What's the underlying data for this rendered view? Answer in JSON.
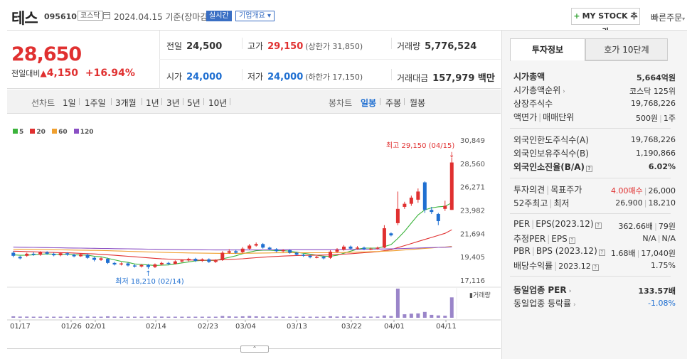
{
  "header": {
    "name": "테스",
    "code": "095610",
    "market": "코스닥",
    "date_text": "2024.04.15 기준(장마감)",
    "live_label": "실시간",
    "overview_label": "기업개요",
    "mystock_label": "MY STOCK 추가",
    "quick_order": "빠른주문"
  },
  "price": {
    "current": "28,650",
    "change_label": "전일대비",
    "change_value": "4,150",
    "change_pct": "+16.94%",
    "prev_label": "전일",
    "prev_value": "24,500",
    "high_label": "고가",
    "high_value": "29,150",
    "upper_limit": "(상한가 31,850)",
    "volume_label": "거래량",
    "volume_value": "5,776,524",
    "open_label": "시가",
    "open_value": "24,000",
    "low_label": "저가",
    "low_value": "24,000",
    "lower_limit": "(하한가 17,150)",
    "amount_label": "거래대금",
    "amount_value": "157,979 백만"
  },
  "periods": {
    "line_chart": "선차트",
    "items": [
      "1일",
      "1주일",
      "3개월",
      "1년",
      "3년",
      "5년",
      "10년"
    ],
    "candle_chart": "봉차트",
    "candle_items": [
      "일봉",
      "주봉",
      "월봉"
    ],
    "candle_active": "일봉"
  },
  "legend": [
    {
      "label": "5",
      "color": "#3bb33b"
    },
    {
      "label": "20",
      "color": "#e03030"
    },
    {
      "label": "60",
      "color": "#f0a030"
    },
    {
      "label": "120",
      "color": "#8a4fc4"
    }
  ],
  "chart_data": {
    "type": "candlestick",
    "y_ticks": [
      "30,849",
      "28,560",
      "26,271",
      "23,982",
      "21,694",
      "19,405",
      "17,116"
    ],
    "ylim": [
      17116,
      30849
    ],
    "x_labels": [
      "01/17",
      "01/26",
      "02/01",
      "02/14",
      "02/23",
      "03/04",
      "03/13",
      "03/22",
      "04/01",
      "04/11"
    ],
    "high_annotation": "최고 29,150 (04/15)",
    "low_annotation": "최저 18,210 (02/14)",
    "volume_label": "거래량",
    "candles": [
      {
        "o": 19800,
        "c": 19500,
        "h": 19950,
        "l": 19350
      },
      {
        "o": 19400,
        "c": 19250,
        "h": 19500,
        "l": 19150
      },
      {
        "o": 19500,
        "c": 19700,
        "h": 19800,
        "l": 19400
      },
      {
        "o": 19700,
        "c": 19600,
        "h": 19850,
        "l": 19500
      },
      {
        "o": 19600,
        "c": 19850,
        "h": 19950,
        "l": 19500
      },
      {
        "o": 19850,
        "c": 19700,
        "h": 19950,
        "l": 19600
      },
      {
        "o": 19700,
        "c": 19550,
        "h": 19800,
        "l": 19450
      },
      {
        "o": 19550,
        "c": 19750,
        "h": 19850,
        "l": 19450
      },
      {
        "o": 19750,
        "c": 19600,
        "h": 19850,
        "l": 19500
      },
      {
        "o": 19600,
        "c": 19450,
        "h": 19700,
        "l": 19350
      },
      {
        "o": 19450,
        "c": 19650,
        "h": 19750,
        "l": 19400
      },
      {
        "o": 19600,
        "c": 19300,
        "h": 19700,
        "l": 19200
      },
      {
        "o": 19300,
        "c": 19100,
        "h": 19400,
        "l": 18950
      },
      {
        "o": 19100,
        "c": 19250,
        "h": 19350,
        "l": 19000
      },
      {
        "o": 19200,
        "c": 18800,
        "h": 19300,
        "l": 18700
      },
      {
        "o": 18800,
        "c": 18650,
        "h": 18900,
        "l": 18550
      },
      {
        "o": 18650,
        "c": 18750,
        "h": 18850,
        "l": 18550
      },
      {
        "o": 18750,
        "c": 18550,
        "h": 18850,
        "l": 18450
      },
      {
        "o": 18550,
        "c": 18450,
        "h": 18650,
        "l": 18350
      },
      {
        "o": 18450,
        "c": 18600,
        "h": 18700,
        "l": 18350
      },
      {
        "o": 18600,
        "c": 18400,
        "h": 18700,
        "l": 18210
      },
      {
        "o": 18400,
        "c": 18650,
        "h": 18750,
        "l": 18300
      },
      {
        "o": 18650,
        "c": 18800,
        "h": 18900,
        "l": 18550
      },
      {
        "o": 18800,
        "c": 18700,
        "h": 18900,
        "l": 18600
      },
      {
        "o": 18700,
        "c": 18950,
        "h": 19050,
        "l": 18650
      },
      {
        "o": 18950,
        "c": 19050,
        "h": 19150,
        "l": 18850
      },
      {
        "o": 19050,
        "c": 19200,
        "h": 19300,
        "l": 18950
      },
      {
        "o": 19200,
        "c": 19000,
        "h": 19300,
        "l": 18900
      },
      {
        "o": 19000,
        "c": 19150,
        "h": 19250,
        "l": 18900
      },
      {
        "o": 19150,
        "c": 18900,
        "h": 19250,
        "l": 18800
      },
      {
        "o": 18900,
        "c": 19050,
        "h": 19150,
        "l": 18800
      },
      {
        "o": 19100,
        "c": 19800,
        "h": 19950,
        "l": 19000
      },
      {
        "o": 19800,
        "c": 19950,
        "h": 20150,
        "l": 19700
      },
      {
        "o": 19950,
        "c": 19800,
        "h": 20100,
        "l": 19700
      },
      {
        "o": 19850,
        "c": 20200,
        "h": 20350,
        "l": 19750
      },
      {
        "o": 20200,
        "c": 20500,
        "h": 20650,
        "l": 20100
      },
      {
        "o": 20500,
        "c": 20650,
        "h": 20800,
        "l": 20400
      },
      {
        "o": 20650,
        "c": 20300,
        "h": 20750,
        "l": 20200
      },
      {
        "o": 20300,
        "c": 20150,
        "h": 20400,
        "l": 20050
      },
      {
        "o": 20150,
        "c": 19950,
        "h": 20250,
        "l": 19850
      },
      {
        "o": 19950,
        "c": 20050,
        "h": 20150,
        "l": 19850
      },
      {
        "o": 20050,
        "c": 19800,
        "h": 20150,
        "l": 19700
      },
      {
        "o": 19800,
        "c": 19600,
        "h": 19900,
        "l": 19500
      },
      {
        "o": 19600,
        "c": 19500,
        "h": 19700,
        "l": 19400
      },
      {
        "o": 19500,
        "c": 19350,
        "h": 19600,
        "l": 19250
      },
      {
        "o": 19350,
        "c": 19400,
        "h": 19500,
        "l": 19250
      },
      {
        "o": 19400,
        "c": 19250,
        "h": 19500,
        "l": 19150
      },
      {
        "o": 19300,
        "c": 19900,
        "h": 20050,
        "l": 19200
      },
      {
        "o": 19900,
        "c": 20100,
        "h": 20250,
        "l": 19800
      },
      {
        "o": 20100,
        "c": 20400,
        "h": 20550,
        "l": 20000
      },
      {
        "o": 20400,
        "c": 20200,
        "h": 20500,
        "l": 20100
      },
      {
        "o": 20200,
        "c": 20300,
        "h": 20450,
        "l": 20100
      },
      {
        "o": 20300,
        "c": 20150,
        "h": 20400,
        "l": 20050
      },
      {
        "o": 20150,
        "c": 20200,
        "h": 20300,
        "l": 20050
      },
      {
        "o": 20200,
        "c": 20300,
        "h": 20400,
        "l": 20100
      },
      {
        "o": 20300,
        "c": 22200,
        "h": 22500,
        "l": 20250
      },
      {
        "o": 21700,
        "c": 21500,
        "h": 21800,
        "l": 21400
      },
      {
        "o": 22700,
        "c": 24100,
        "h": 25800,
        "l": 22500
      },
      {
        "o": 24300,
        "c": 24600,
        "h": 24800,
        "l": 24100
      },
      {
        "o": 24600,
        "c": 25200,
        "h": 25400,
        "l": 24400
      },
      {
        "o": 25000,
        "c": 25800,
        "h": 26100,
        "l": 24700
      },
      {
        "o": 26700,
        "c": 24000,
        "h": 26800,
        "l": 23700
      },
      {
        "o": 24000,
        "c": 23800,
        "h": 24300,
        "l": 23600
      },
      {
        "o": 23600,
        "c": 22900,
        "h": 23700,
        "l": 22500
      },
      {
        "o": 24100,
        "c": 24400,
        "h": 24900,
        "l": 23900
      },
      {
        "o": 24000,
        "c": 28650,
        "h": 29150,
        "l": 24000
      }
    ],
    "volume_levels": [
      0.05,
      0.04,
      0.04,
      0.03,
      0.03,
      0.03,
      0.03,
      0.03,
      0.03,
      0.03,
      0.03,
      0.04,
      0.03,
      0.03,
      0.05,
      0.04,
      0.03,
      0.03,
      0.03,
      0.03,
      0.04,
      0.04,
      0.04,
      0.03,
      0.03,
      0.03,
      0.03,
      0.03,
      0.03,
      0.03,
      0.03,
      0.06,
      0.05,
      0.04,
      0.05,
      0.06,
      0.05,
      0.04,
      0.04,
      0.04,
      0.03,
      0.03,
      0.03,
      0.03,
      0.03,
      0.03,
      0.03,
      0.05,
      0.04,
      0.05,
      0.04,
      0.04,
      0.04,
      0.04,
      0.04,
      0.08,
      0.06,
      1.0,
      0.12,
      0.14,
      0.15,
      0.2,
      0.1,
      0.08,
      0.07,
      0.7
    ],
    "ma_lines": [
      {
        "name": "5",
        "color": "#3bb33b",
        "values": [
          19600,
          19550,
          19560,
          19600,
          19650,
          19680,
          19660,
          19640,
          19650,
          19600,
          19580,
          19560,
          19450,
          19400,
          19250,
          19100,
          18950,
          18850,
          18700,
          18650,
          18600,
          18550,
          18580,
          18600,
          18700,
          18800,
          18900,
          19000,
          19050,
          19050,
          19050,
          19200,
          19350,
          19500,
          19700,
          19850,
          20000,
          20050,
          20050,
          20000,
          20000,
          19950,
          19850,
          19750,
          19650,
          19550,
          19450,
          19450,
          19550,
          19750,
          19950,
          20150,
          20250,
          20250,
          20250,
          20400,
          20600,
          21200,
          21900,
          22700,
          23500,
          24000,
          24200,
          24300,
          24350,
          24700
        ]
      },
      {
        "name": "20",
        "color": "#e03030",
        "values": [
          19950,
          19930,
          19910,
          19890,
          19870,
          19850,
          19830,
          19810,
          19790,
          19770,
          19740,
          19710,
          19680,
          19640,
          19600,
          19550,
          19500,
          19450,
          19400,
          19350,
          19300,
          19250,
          19200,
          19170,
          19140,
          19110,
          19090,
          19080,
          19070,
          19070,
          19080,
          19100,
          19130,
          19170,
          19210,
          19260,
          19310,
          19360,
          19400,
          19440,
          19470,
          19500,
          19520,
          19540,
          19550,
          19560,
          19570,
          19590,
          19620,
          19660,
          19700,
          19750,
          19800,
          19850,
          19900,
          20000,
          20100,
          20300,
          20500,
          20700,
          20900,
          21100,
          21300,
          21500,
          21700,
          22050
        ]
      },
      {
        "name": "60",
        "color": "#f0a030",
        "values": [
          20150,
          20140,
          20130,
          20120,
          20110,
          20100,
          20090,
          20080,
          20070,
          20060,
          20050,
          20040,
          20030,
          20020,
          20000,
          19980,
          19960,
          19940,
          19920,
          19900,
          19880,
          19860,
          19840,
          19820,
          19800,
          19790,
          19780,
          19770,
          19760,
          19750,
          19745,
          19740,
          19740,
          19740,
          19745,
          19750,
          19760,
          19770,
          19780,
          19790,
          19795,
          19800,
          19800,
          19800,
          19800,
          19800,
          19800,
          19800,
          19810,
          19820,
          19840,
          19860,
          19880,
          19900,
          19920,
          19950,
          19980,
          20020,
          20070,
          20120,
          20170,
          20220,
          20270,
          20320,
          20360,
          20420
        ]
      },
      {
        "name": "120",
        "color": "#8a4fc4",
        "values": [
          20350,
          20340,
          20330,
          20320,
          20310,
          20300,
          20290,
          20280,
          20270,
          20260,
          20250,
          20240,
          20230,
          20220,
          20210,
          20200,
          20190,
          20180,
          20170,
          20160,
          20150,
          20140,
          20130,
          20120,
          20110,
          20100,
          20095,
          20090,
          20085,
          20080,
          20075,
          20070,
          20070,
          20070,
          20070,
          20070,
          20075,
          20080,
          20085,
          20090,
          20095,
          20100,
          20100,
          20100,
          20100,
          20100,
          20100,
          20100,
          20105,
          20110,
          20120,
          20130,
          20140,
          20150,
          20160,
          20170,
          20180,
          20200,
          20220,
          20240,
          20260,
          20280,
          20300,
          20320,
          20340,
          20370
        ]
      }
    ]
  },
  "right": {
    "tab_active": "투자정보",
    "tab_inactive": "호가 10단계",
    "g1": [
      {
        "k": "시가총액",
        "v": "5,664억원",
        "bold": true
      },
      {
        "k": "시가총액순위",
        "v": "코스닥 125위"
      },
      {
        "k": "상장주식수",
        "v": "19,768,226"
      },
      {
        "k": "액면가",
        "k2": "매매단위",
        "v": "500원",
        "v2": "1주"
      }
    ],
    "g2": [
      {
        "k": "외국인한도주식수(A)",
        "v": "19,768,226"
      },
      {
        "k": "외국인보유주식수(B)",
        "v": "1,190,866"
      },
      {
        "k": "외국인소진율(B/A)",
        "v": "6.02%",
        "bold": true
      }
    ],
    "g3": [
      {
        "k": "투자의견",
        "k2": "목표주가",
        "v": "4.00매수",
        "v2": "26,000"
      },
      {
        "k": "52주최고",
        "k2": "최저",
        "v": "26,900",
        "v2": "18,210"
      }
    ],
    "g4": [
      {
        "k": "PER",
        "k2": "EPS(2023.12)",
        "v": "362.66배",
        "v2": "79원"
      },
      {
        "k": "추정PER",
        "k2": "EPS",
        "v": "N/A",
        "v2": "N/A"
      },
      {
        "k": "PBR",
        "k2": "BPS (2023.12)",
        "v": "1.68배",
        "v2": "17,040원"
      },
      {
        "k": "배당수익률",
        "k2": "2023.12",
        "v": "1.75%"
      }
    ],
    "g5": [
      {
        "k": "동일업종 PER",
        "v": "133.57배",
        "bold": true
      },
      {
        "k": "동일업종 등락률",
        "v": "-1.08%"
      }
    ]
  }
}
